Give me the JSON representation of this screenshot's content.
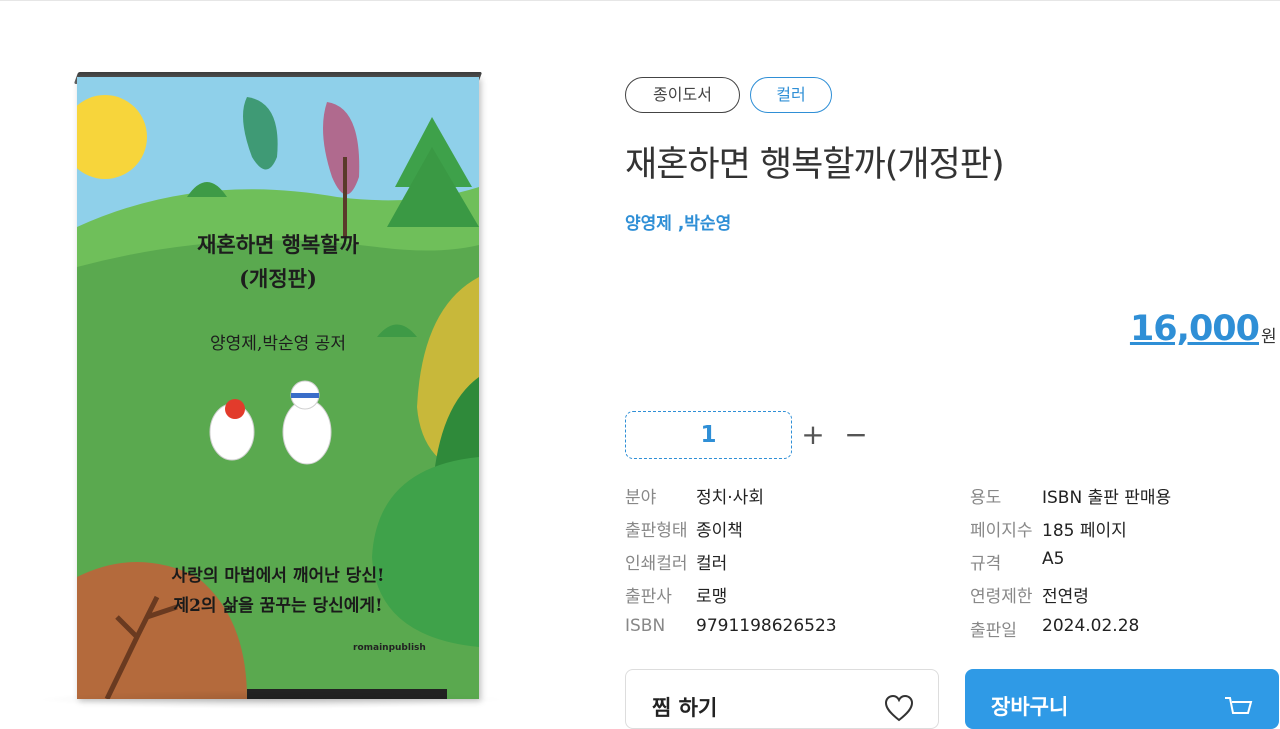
{
  "cover": {
    "title_line1": "재혼하면 행복할까",
    "title_line2": "(개정판)",
    "authors": "양영제,박순영 공저",
    "tagline1": "사랑의 마법에서 깨어난 당신!",
    "tagline2": "제2의 삶을 꿈꾸는 당신에게!",
    "publisher": "romainpublish"
  },
  "chips": {
    "paper": "종이도서",
    "color": "컬러"
  },
  "title": "재혼하면 행복할까(개정판)",
  "authors": "양영제 ,박순영",
  "price": {
    "amount": "16,000",
    "unit": "원"
  },
  "quantity": {
    "value": "1",
    "plus": "+",
    "minus": "−"
  },
  "specs_left": [
    {
      "label": "분야",
      "value": "정치·사회"
    },
    {
      "label": "출판형태",
      "value": "종이책"
    },
    {
      "label": "인쇄컬러",
      "value": "컬러"
    },
    {
      "label": "출판사",
      "value": "로맹"
    },
    {
      "label": "ISBN",
      "value": "9791198626523"
    }
  ],
  "specs_right": [
    {
      "label": "용도",
      "value": "ISBN 출판 판매용"
    },
    {
      "label": "페이지수",
      "value": "185 페이지"
    },
    {
      "label": "규격",
      "value": "A5"
    },
    {
      "label": "연령제한",
      "value": "전연령"
    },
    {
      "label": "출판일",
      "value": "2024.02.28"
    }
  ],
  "buttons": {
    "wish": "찜 하기",
    "cart": "장바구니"
  },
  "colors": {
    "accent": "#2f8fd6",
    "cart_bg": "#2f9ae6"
  }
}
